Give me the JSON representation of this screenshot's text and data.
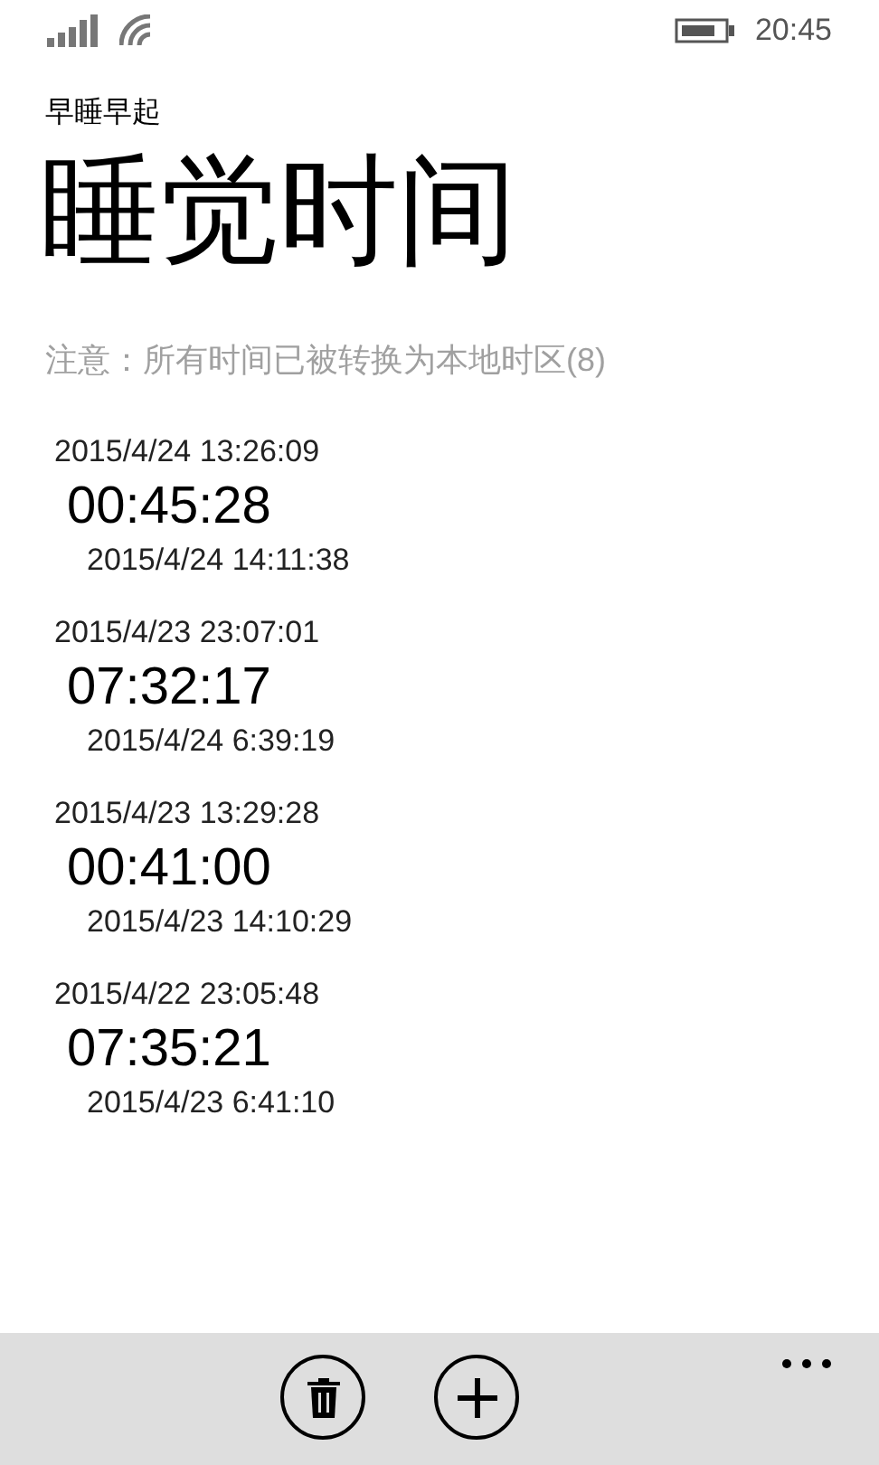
{
  "status_bar": {
    "time": "20:45"
  },
  "app_title": "早睡早起",
  "page_title": "睡觉时间",
  "note": "注意：所有时间已被转换为本地时区(8)",
  "sessions": [
    {
      "start": "2015/4/24 13:26:09",
      "duration": "00:45:28",
      "end": "2015/4/24 14:11:38"
    },
    {
      "start": "2015/4/23 23:07:01",
      "duration": "07:32:17",
      "end": "2015/4/24 6:39:19"
    },
    {
      "start": "2015/4/23 13:29:28",
      "duration": "00:41:00",
      "end": "2015/4/23 14:10:29"
    },
    {
      "start": "2015/4/22 23:05:48",
      "duration": "07:35:21",
      "end": "2015/4/23 6:41:10"
    }
  ]
}
